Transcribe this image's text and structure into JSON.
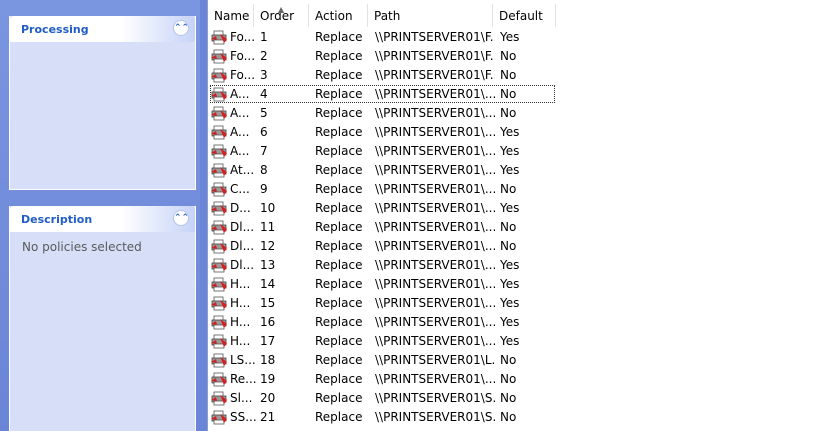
{
  "processing": {
    "title": "Processing"
  },
  "description": {
    "title": "Description",
    "text": "No policies selected"
  },
  "list": {
    "columns": [
      "Name",
      "Order",
      "Action",
      "Path",
      "Default"
    ],
    "rows": [
      {
        "name": "Fo...",
        "order": "1",
        "action": "Replace",
        "path": "\\\\PRINTSERVER01\\F...",
        "default": "Yes"
      },
      {
        "name": "Fo...",
        "order": "2",
        "action": "Replace",
        "path": "\\\\PRINTSERVER01\\F...",
        "default": "No"
      },
      {
        "name": "Fo...",
        "order": "3",
        "action": "Replace",
        "path": "\\\\PRINTSERVER01\\F...",
        "default": "No"
      },
      {
        "name": "A...",
        "order": "4",
        "action": "Replace",
        "path": "\\\\PRINTSERVER01\\...",
        "default": "No"
      },
      {
        "name": "A...",
        "order": "5",
        "action": "Replace",
        "path": "\\\\PRINTSERVER01\\...",
        "default": "No"
      },
      {
        "name": "A...",
        "order": "6",
        "action": "Replace",
        "path": "\\\\PRINTSERVER01\\...",
        "default": "Yes"
      },
      {
        "name": "A...",
        "order": "7",
        "action": "Replace",
        "path": "\\\\PRINTSERVER01\\...",
        "default": "Yes"
      },
      {
        "name": "At...",
        "order": "8",
        "action": "Replace",
        "path": "\\\\PRINTSERVER01\\...",
        "default": "Yes"
      },
      {
        "name": "C...",
        "order": "9",
        "action": "Replace",
        "path": "\\\\PRINTSERVER01\\...",
        "default": "No"
      },
      {
        "name": "D...",
        "order": "10",
        "action": "Replace",
        "path": "\\\\PRINTSERVER01\\...",
        "default": "Yes"
      },
      {
        "name": "Dl...",
        "order": "11",
        "action": "Replace",
        "path": "\\\\PRINTSERVER01\\...",
        "default": "No"
      },
      {
        "name": "Dl...",
        "order": "12",
        "action": "Replace",
        "path": "\\\\PRINTSERVER01\\...",
        "default": "No"
      },
      {
        "name": "Dl...",
        "order": "13",
        "action": "Replace",
        "path": "\\\\PRINTSERVER01\\...",
        "default": "Yes"
      },
      {
        "name": "H...",
        "order": "14",
        "action": "Replace",
        "path": "\\\\PRINTSERVER01\\...",
        "default": "Yes"
      },
      {
        "name": "H...",
        "order": "15",
        "action": "Replace",
        "path": "\\\\PRINTSERVER01\\...",
        "default": "Yes"
      },
      {
        "name": "H...",
        "order": "16",
        "action": "Replace",
        "path": "\\\\PRINTSERVER01\\...",
        "default": "Yes"
      },
      {
        "name": "H...",
        "order": "17",
        "action": "Replace",
        "path": "\\\\PRINTSERVER01\\...",
        "default": "Yes"
      },
      {
        "name": "LS...",
        "order": "18",
        "action": "Replace",
        "path": "\\\\PRINTSERVER01\\L...",
        "default": "No"
      },
      {
        "name": "Re...",
        "order": "19",
        "action": "Replace",
        "path": "\\\\PRINTSERVER01\\...",
        "default": "No"
      },
      {
        "name": "Sl...",
        "order": "20",
        "action": "Replace",
        "path": "\\\\PRINTSERVER01\\S...",
        "default": "No"
      },
      {
        "name": "SS...",
        "order": "21",
        "action": "Replace",
        "path": "\\\\PRINTSERVER01\\S...",
        "default": "No"
      }
    ],
    "focused_row": 3
  },
  "icons": {
    "collapse": "double-chevron-up-icon",
    "row": "printer-icon"
  }
}
